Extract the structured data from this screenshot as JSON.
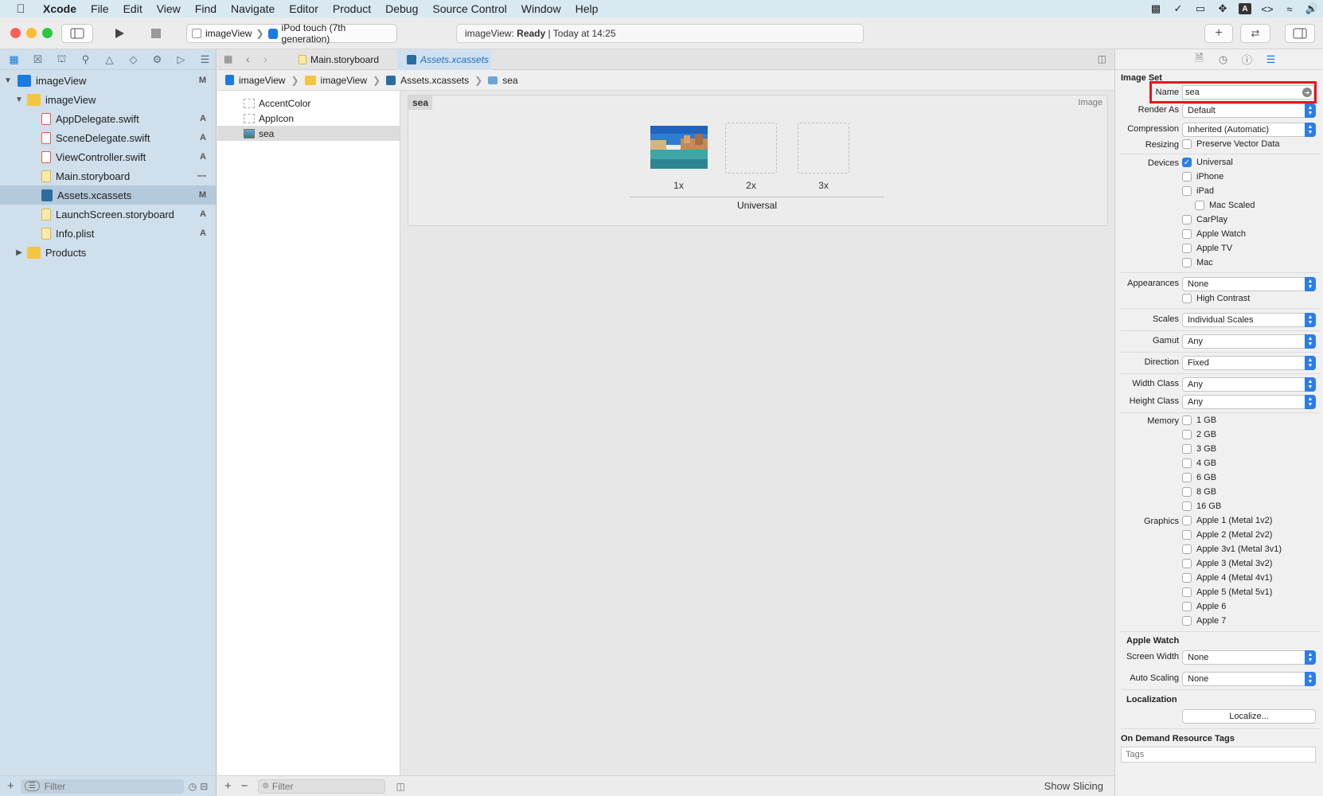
{
  "menubar": {
    "app": "Xcode",
    "items": [
      "File",
      "Edit",
      "View",
      "Find",
      "Navigate",
      "Editor",
      "Product",
      "Debug",
      "Source Control",
      "Window",
      "Help"
    ]
  },
  "toolbar": {
    "scheme_project": "imageView",
    "scheme_device": "iPod touch (7th generation)",
    "status_project": "imageView:",
    "status_state": "Ready",
    "status_time": "| Today at 14:25"
  },
  "navigator": {
    "tree": [
      {
        "label": "imageView",
        "badge": "M",
        "type": "project"
      },
      {
        "label": "imageView",
        "badge": "",
        "type": "folder"
      },
      {
        "label": "AppDelegate.swift",
        "badge": "A",
        "type": "swift"
      },
      {
        "label": "SceneDelegate.swift",
        "badge": "A",
        "type": "swift"
      },
      {
        "label": "ViewController.swift",
        "badge": "A",
        "type": "swift"
      },
      {
        "label": "Main.storyboard",
        "badge": "—",
        "type": "storyboard"
      },
      {
        "label": "Assets.xcassets",
        "badge": "M",
        "type": "assets"
      },
      {
        "label": "LaunchScreen.storyboard",
        "badge": "A",
        "type": "storyboard"
      },
      {
        "label": "Info.plist",
        "badge": "A",
        "type": "plist"
      },
      {
        "label": "Products",
        "badge": "",
        "type": "folder"
      }
    ],
    "filter_placeholder": "Filter"
  },
  "editor": {
    "tabs": [
      "Main.storyboard",
      "Assets.xcassets"
    ],
    "jumpbar": [
      "imageView",
      "imageView",
      "Assets.xcassets",
      "sea"
    ],
    "assets": [
      "AccentColor",
      "AppIcon",
      "sea"
    ],
    "set_name": "sea",
    "set_kind": "Image",
    "wells": [
      "1x",
      "2x",
      "3x"
    ],
    "group_label": "Universal",
    "filter_placeholder": "Filter",
    "show_slicing": "Show Slicing"
  },
  "inspector": {
    "section_title": "Image Set",
    "name_label": "Name",
    "name_value": "sea",
    "render_as_label": "Render As",
    "render_as": "Default",
    "compression_label": "Compression",
    "compression": "Inherited (Automatic)",
    "resizing_label": "Resizing",
    "resizing_option": "Preserve Vector Data",
    "devices_label": "Devices",
    "devices": [
      "Universal",
      "iPhone",
      "iPad",
      "Mac Scaled",
      "CarPlay",
      "Apple Watch",
      "Apple TV",
      "Mac"
    ],
    "appearances_label": "Appearances",
    "appearances": "None",
    "high_contrast": "High Contrast",
    "scales_label": "Scales",
    "scales": "Individual Scales",
    "gamut_label": "Gamut",
    "gamut": "Any",
    "direction_label": "Direction",
    "direction": "Fixed",
    "width_class_label": "Width Class",
    "width_class": "Any",
    "height_class_label": "Height Class",
    "height_class": "Any",
    "memory_label": "Memory",
    "memory": [
      "1 GB",
      "2 GB",
      "3 GB",
      "4 GB",
      "6 GB",
      "8 GB",
      "16 GB"
    ],
    "graphics_label": "Graphics",
    "graphics": [
      "Apple 1 (Metal 1v2)",
      "Apple 2 (Metal 2v2)",
      "Apple 3v1 (Metal 3v1)",
      "Apple 3 (Metal 3v2)",
      "Apple 4 (Metal 4v1)",
      "Apple 5 (Metal 5v1)",
      "Apple 6",
      "Apple 7"
    ],
    "watch_section": "Apple Watch",
    "screen_width_label": "Screen Width",
    "screen_width": "None",
    "auto_scaling_label": "Auto Scaling",
    "auto_scaling": "None",
    "localization_section": "Localization",
    "localize_button": "Localize...",
    "odr_section": "On Demand Resource Tags",
    "tags_placeholder": "Tags"
  },
  "colors": {
    "accent": "#2b7de9",
    "highlight_box": "#e8161b",
    "menubar": "#d9e9f2",
    "sidebar": "#cfdfec"
  }
}
